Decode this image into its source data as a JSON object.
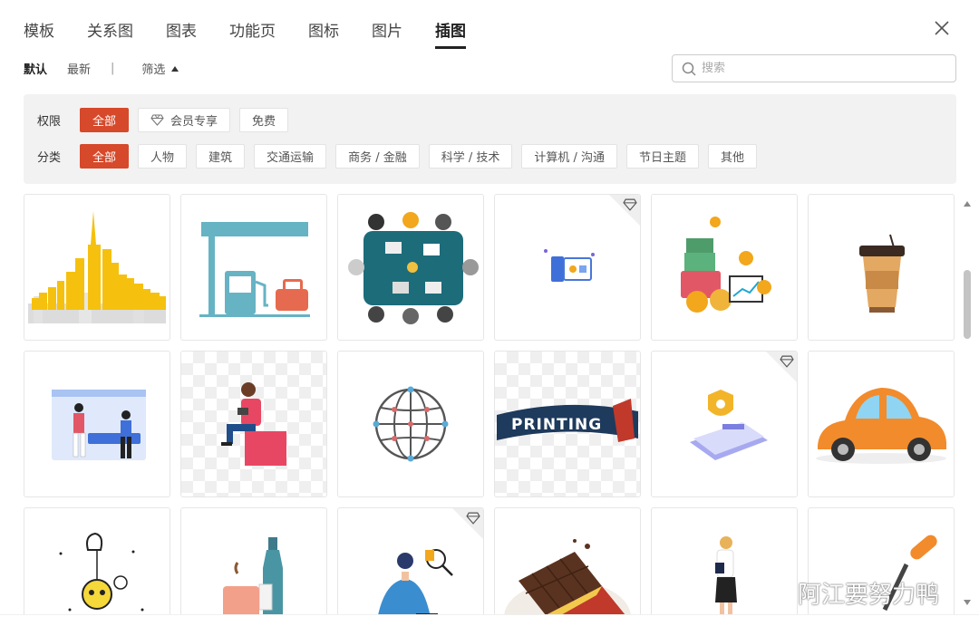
{
  "tabs": [
    {
      "label": "模板",
      "active": false
    },
    {
      "label": "关系图",
      "active": false
    },
    {
      "label": "图表",
      "active": false
    },
    {
      "label": "功能页",
      "active": false
    },
    {
      "label": "图标",
      "active": false
    },
    {
      "label": "图片",
      "active": false
    },
    {
      "label": "插图",
      "active": true
    }
  ],
  "sort": {
    "default": "默认",
    "latest": "最新",
    "separator": "|",
    "filter": "筛选"
  },
  "search": {
    "placeholder": "搜索",
    "value": ""
  },
  "filter_rows": {
    "permission": {
      "label": "权限",
      "options": [
        {
          "label": "全部",
          "active": true,
          "icon": ""
        },
        {
          "label": "会员专享",
          "active": false,
          "icon": "diamond-icon"
        },
        {
          "label": "免费",
          "active": false,
          "icon": ""
        }
      ]
    },
    "category": {
      "label": "分类",
      "options": [
        {
          "label": "全部",
          "active": true
        },
        {
          "label": "人物",
          "active": false
        },
        {
          "label": "建筑",
          "active": false
        },
        {
          "label": "交通运输",
          "active": false
        },
        {
          "label": "商务 / 金融",
          "active": false
        },
        {
          "label": "科学 / 技术",
          "active": false
        },
        {
          "label": "计算机 / 沟通",
          "active": false
        },
        {
          "label": "节日主题",
          "active": false
        },
        {
          "label": "其他",
          "active": false
        }
      ]
    }
  },
  "illustrations": [
    {
      "subject": "city-skyline",
      "premium": false
    },
    {
      "subject": "gas-station",
      "premium": false
    },
    {
      "subject": "team-meeting",
      "premium": false
    },
    {
      "subject": "id-card-device",
      "premium": true
    },
    {
      "subject": "finance-coins",
      "premium": false
    },
    {
      "subject": "coffee-cup",
      "premium": false
    },
    {
      "subject": "team-web-design",
      "premium": false
    },
    {
      "subject": "man-sitting-box",
      "premium": false
    },
    {
      "subject": "globe-network",
      "premium": false
    },
    {
      "subject": "printing-banner",
      "premium": false,
      "text": "PRINTING"
    },
    {
      "subject": "security-shield-card",
      "premium": true
    },
    {
      "subject": "orange-car",
      "premium": false
    },
    {
      "subject": "skull-lightbulb-doodle",
      "premium": false
    },
    {
      "subject": "cup-and-bottle",
      "premium": false
    },
    {
      "subject": "scientist-microscope",
      "premium": true
    },
    {
      "subject": "chocolate-bar",
      "premium": false
    },
    {
      "subject": "businesswoman",
      "premium": false
    },
    {
      "subject": "paint-roller",
      "premium": false
    }
  ],
  "watermark": {
    "text": "阿江要努力鸭"
  },
  "colors": {
    "accent": "#d6492a",
    "filter_bg": "#f2f2f3"
  }
}
